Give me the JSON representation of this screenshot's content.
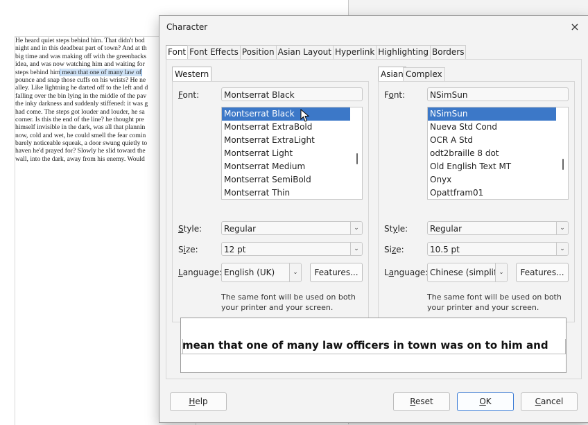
{
  "document": {
    "lines": [
      {
        "text": "He heard quiet steps behind him. That didn't bod"
      },
      {
        "text": "night and in this deadbeat part of town? And at th"
      },
      {
        "text": "big time and was making off with the greenbacks"
      },
      {
        "text": "idea, and was now watching him and waiting for"
      },
      {
        "pre": "steps behind him",
        "hl": " mean that one of many law of",
        "post": ""
      },
      {
        "text": "pounce and snap those cuffs on his wrists? He ne"
      },
      {
        "text": "alley. Like lightning he darted off to the left and d"
      },
      {
        "text": "falling over the bin lying in the middle of the pav"
      },
      {
        "text": "the inky darkness and suddenly stiffened: it was g"
      },
      {
        "text": "had come. The steps got louder and louder, he sa"
      },
      {
        "text": "corner. Is this the end of the line? he thought pre"
      },
      {
        "text": "himself invisible in the dark, was all that plannin"
      },
      {
        "text": "now, cold and wet, he could smell the fear comin"
      },
      {
        "text": "barely noticeable squeak, a door swung quietly to"
      },
      {
        "text": "haven he'd prayed for? Slowly he slid toward the"
      },
      {
        "text": "wall, into the dark, away from his enemy. Would"
      }
    ]
  },
  "dialog": {
    "title": "Character",
    "close_icon": "×",
    "tabs": [
      "Font",
      "Font Effects",
      "Position",
      "Asian Layout",
      "Hyperlink",
      "Highlighting",
      "Borders"
    ],
    "western": {
      "tab": "Western",
      "font_label": "Font:",
      "font_value": "Montserrat Black",
      "font_list": [
        "Montserrat Black",
        "Montserrat ExtraBold",
        "Montserrat ExtraLight",
        "Montserrat Light",
        "Montserrat Medium",
        "Montserrat SemiBold",
        "Montserrat Thin"
      ],
      "style_label": "Style:",
      "style_value": "Regular",
      "size_label": "Size:",
      "size_value": "12 pt",
      "language_label": "Language:",
      "language_value": "English (UK)",
      "features_button": "Features...",
      "note": "The same font will be used on both your printer and your screen."
    },
    "asian": {
      "tab": "Asian",
      "complex_tab": "Complex",
      "font_label": "Font:",
      "font_value": "NSimSun",
      "font_list": [
        "NSimSun",
        "Nueva Std Cond",
        "OCR A Std",
        "odt2braille 8 dot",
        "Old English Text MT",
        "Onyx",
        "Opattfram01"
      ],
      "style_label": "Style:",
      "style_value": "Regular",
      "size_label": "Size:",
      "size_value": "10.5 pt",
      "language_label": "Language:",
      "language_value": "Chinese (simplified)",
      "features_button": "Features...",
      "note": "The same font will be used on both your printer and your screen."
    },
    "preview_text": "mean that one of many law officers in town was on to him  and",
    "buttons": {
      "help": "Help",
      "reset": "Reset",
      "ok": "OK",
      "cancel": "Cancel"
    }
  }
}
